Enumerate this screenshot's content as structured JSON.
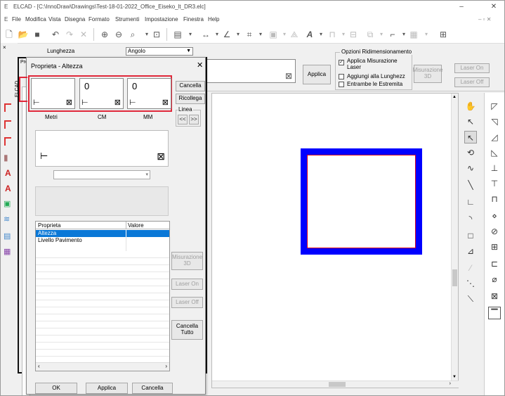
{
  "window": {
    "title": "ELCAD - [C:\\InnoDraw\\Drawings\\Test-18-01-2022_Office_Eiseko_lt_DR3.elc]"
  },
  "menu": {
    "items": [
      "File",
      "Modifica",
      "Vista",
      "Disegna",
      "Formato",
      "Strumenti",
      "Impostazione",
      "Finestra",
      "Help"
    ]
  },
  "options": {
    "lunghezza_label": "Lunghezza",
    "angolo_value": "Angolo",
    "group_title": "Opzioni Ridimensionamento",
    "check_laser": "Applica Misurazione Laser",
    "check_aggiungi": "Aggiungi alla Lunghezz",
    "check_entrambe": "Entrambe le Estremita",
    "applica": "Applica",
    "misurazione3d": "Misurazione 3D",
    "laser_on": "Laser On",
    "laser_off": "Laser Off"
  },
  "leftwin": {
    "side_label": "ELCAD",
    "tab_label": "Pro"
  },
  "dialog": {
    "title": "Proprieta - Altezza",
    "metri_value": "",
    "cm_value": "0",
    "mm_value": "0",
    "metri_label": "Metri",
    "cm_label": "CM",
    "mm_label": "MM",
    "cancella": "Cancella",
    "ricollega": "Ricollega",
    "linea_label": "Linea",
    "prev": "<<",
    "next": ">>",
    "table_header_prop": "Proprieta",
    "table_header_val": "Valore",
    "rows": [
      "Altezza",
      "Livello Pavimento"
    ],
    "misurazione3d": "Misurazione 3D",
    "laser_on": "Laser On",
    "laser_off": "Laser Off",
    "cancella_tutto": "Cancella Tutto",
    "ok": "OK",
    "applica": "Applica",
    "cancel": "Cancella"
  },
  "colors": {
    "highlight_red": "#e0283a",
    "selection_blue": "#0a78d7",
    "shape_blue": "#0000ff",
    "shape_red": "#d2001e"
  }
}
